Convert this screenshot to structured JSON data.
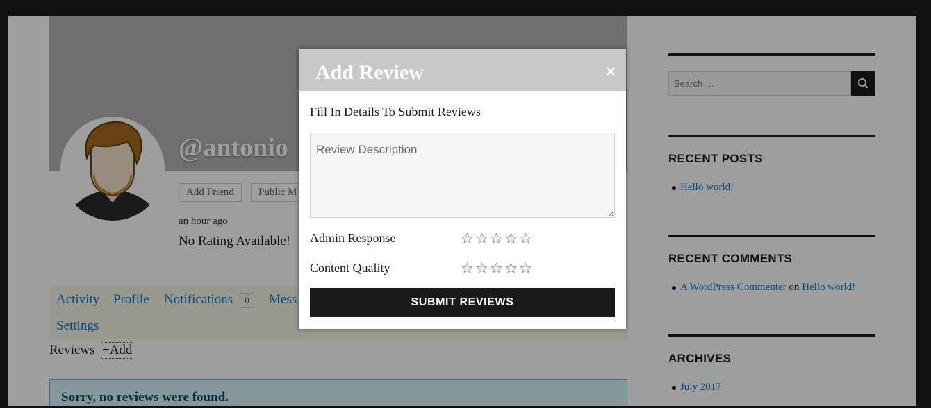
{
  "profile": {
    "username": "@antonio",
    "add_friend": "Add Friend",
    "public_message": "Public M",
    "last_active": "an hour ago",
    "rating_text": "No Rating Available!"
  },
  "nav": {
    "items": [
      "Activity",
      "Profile",
      "Notifications",
      "Mess",
      "Settings"
    ],
    "notifications_count": "0"
  },
  "reviews": {
    "label": "Reviews",
    "add": "+Add",
    "empty": "Sorry, no reviews were found."
  },
  "sidebar": {
    "search_placeholder": "Search …",
    "recent_posts_title": "RECENT POSTS",
    "recent_posts": [
      "Hello world!"
    ],
    "recent_comments_title": "RECENT COMMENTS",
    "comment_author": "A WordPress Commenter",
    "comment_on": "on",
    "comment_post": "Hello world!",
    "archives_title": "ARCHIVES",
    "archives": [
      "July 2017"
    ]
  },
  "modal": {
    "title": "Add Review",
    "close": "×",
    "subtitle": "Fill In Details To Submit Reviews",
    "description_placeholder": "Review Description",
    "criteria": [
      {
        "label": "Admin Response",
        "rating": 0,
        "max": 5
      },
      {
        "label": "Content Quality",
        "rating": 0,
        "max": 5
      }
    ],
    "submit": "SUBMIT REVIEWS"
  },
  "colors": {
    "link": "#007acc",
    "dark": "#1a1a1a",
    "modal_header": "#c8c8c8"
  }
}
